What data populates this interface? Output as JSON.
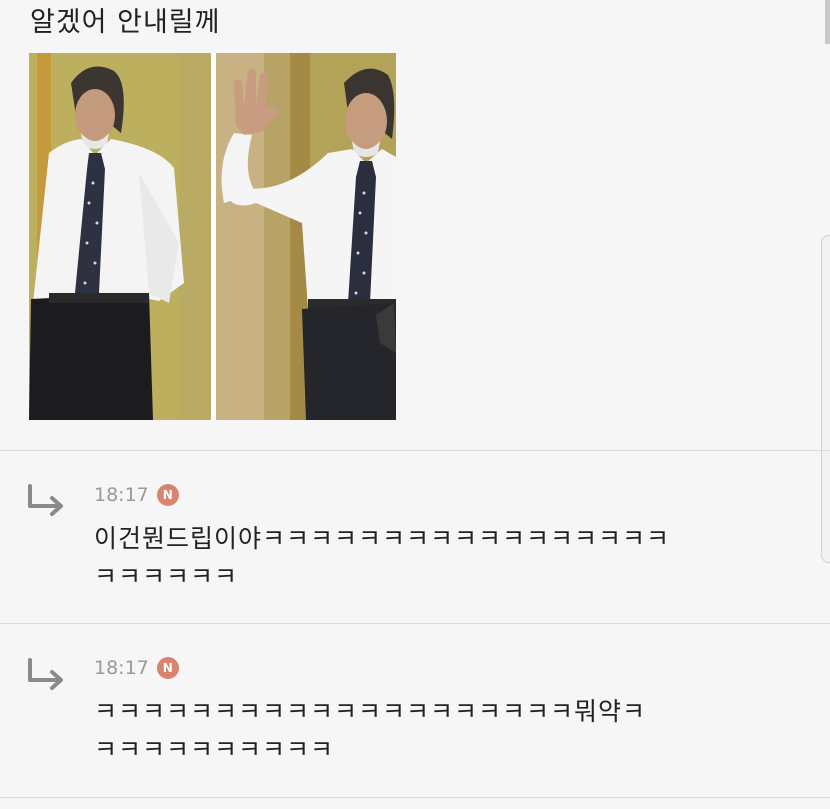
{
  "post": {
    "text": "알겠어 안내릴께"
  },
  "comments": [
    {
      "time": "18:17",
      "badge": "N",
      "line1": "이건뭔드립이야ㅋㅋㅋㅋㅋㅋㅋㅋㅋㅋㅋㅋㅋㅋㅋㅋㅋ",
      "line2": "ㅋㅋㅋㅋㅋㅋ"
    },
    {
      "time": "18:17",
      "badge": "N",
      "line1": "ㅋㅋㅋㅋㅋㅋㅋㅋㅋㅋㅋㅋㅋㅋㅋㅋㅋㅋㅋㅋ뭐약ㅋ",
      "line2": "ㅋㅋㅋㅋㅋㅋㅋㅋㅋㅋ"
    }
  ],
  "colors": {
    "background": "#f6f6f6",
    "badge": "#d8846e",
    "timestamp": "#9a9a9a",
    "divider": "#dcdcdc"
  },
  "icons": {
    "reply": "reply-arrow-icon",
    "new": "new-badge-icon"
  }
}
